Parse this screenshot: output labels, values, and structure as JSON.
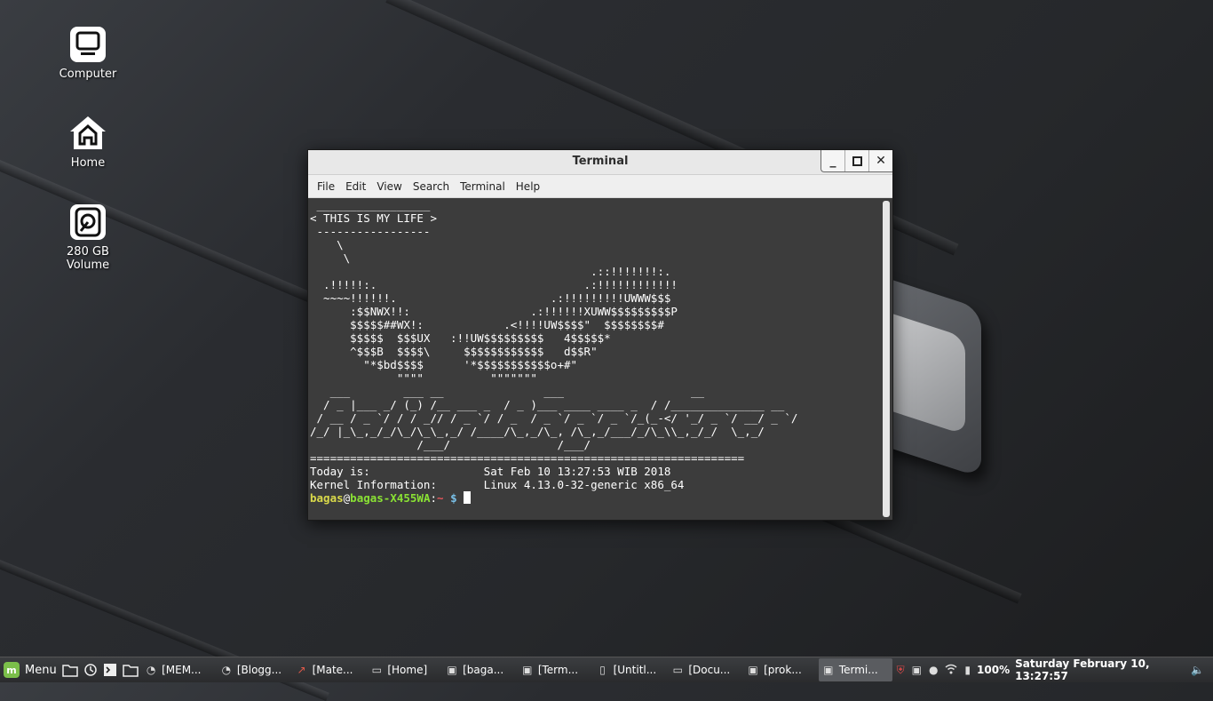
{
  "desktop": {
    "icons": [
      {
        "label": "Computer"
      },
      {
        "label": "Home"
      },
      {
        "label": "280 GB Volume"
      }
    ]
  },
  "window": {
    "title": "Terminal",
    "menu": [
      "File",
      "Edit",
      "View",
      "Search",
      "Terminal",
      "Help"
    ],
    "terminal_output": " _________________\n< THIS IS MY LIFE >\n -----------------\n    \\\n     \\\n                                          .::!!!!!!!:.\n  .!!!!!:.                               .:!!!!!!!!!!!!\n  ~~~~!!!!!!.                       .:!!!!!!!!!UWWW$$$\n      :$$NWX!!:                  .:!!!!!!XUWW$$$$$$$$$P\n      $$$$$##WX!:            .<!!!!UW$$$$\"  $$$$$$$$#\n      $$$$$  $$$UX   :!!UW$$$$$$$$$   4$$$$$*\n      ^$$$B  $$$$\\     $$$$$$$$$$$$   d$$R\"\n        \"*$bd$$$$      '*$$$$$$$$$$$o+#\"\n             \"\"\"\"          \"\"\"\"\"\"\"\n   ___        ___ __               ___                   __\n  / _ |___ _/ (_) /__ ___ _  / _ )___ ____ ____ _  / /______________ __\n / __ / _ `/ / / _// / _ `/ / _  / _ `/ _ `/ _ `/_(_-</ '_/ _ `/ __/ _ `/\n/_/ |_\\_,_/_/\\_/\\_\\_,_/ /____/\\_,_/\\_, /\\_,_/___/_/\\_\\\\_,_/_/  \\_,_/\n                /___/                /___/\n=================================================================\nToday is:                 Sat Feb 10 13:27:53 WIB 2018\nKernel Information:       Linux 4.13.0-32-generic x86_64",
    "prompt": {
      "user": "bagas",
      "at": "@",
      "host": "bagas-X455WA",
      "colon": ":",
      "path": "~",
      "sign": " $ "
    }
  },
  "taskbar": {
    "menu_label": "Menu",
    "tasks": [
      {
        "label": "[MEM...",
        "icon": "app-icon"
      },
      {
        "label": "[Blogg...",
        "icon": "app-icon"
      },
      {
        "label": "[Mate...",
        "icon": "chart-icon"
      },
      {
        "label": "[Home]",
        "icon": "folder-icon"
      },
      {
        "label": "[baga...",
        "icon": "terminal-icon"
      },
      {
        "label": "[Term...",
        "icon": "terminal-icon"
      },
      {
        "label": "[Untitl...",
        "icon": "document-icon"
      },
      {
        "label": "[Docu...",
        "icon": "folder-icon"
      },
      {
        "label": "[prok...",
        "icon": "terminal-icon"
      },
      {
        "label": "Termi...",
        "icon": "terminal-icon"
      }
    ],
    "battery": "100%",
    "clock": "Saturday February 10, 13:27:57"
  }
}
